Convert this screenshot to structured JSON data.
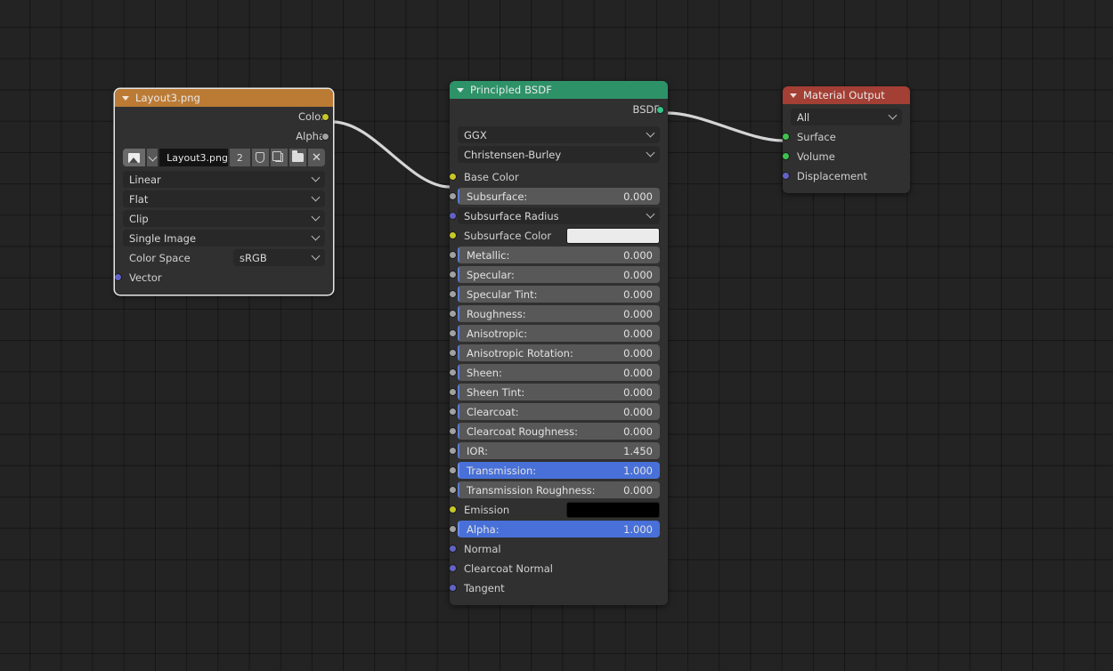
{
  "editor": {
    "name": "Blender Shader Node Editor",
    "background_color": "#232323",
    "grid_color": "#1a1a1a"
  },
  "nodes": {
    "image_texture": {
      "title": "Layout3.png",
      "header_color": "#bb7b35",
      "selected": true,
      "outputs": [
        {
          "label": "Color",
          "socket": "color"
        },
        {
          "label": "Alpha",
          "socket": "gray"
        }
      ],
      "datablock": {
        "image_icon": "image-icon",
        "browse_icon": "chevron-down-icon",
        "name": "Layout3.png",
        "users": "2",
        "fake_user_icon": "shield-icon",
        "new_icon": "copy-icon",
        "open_icon": "folder-icon",
        "unlink_icon": "x-icon"
      },
      "dropdowns": [
        {
          "name": "interpolation",
          "value": "Linear"
        },
        {
          "name": "projection",
          "value": "Flat"
        },
        {
          "name": "extension",
          "value": "Clip"
        },
        {
          "name": "source",
          "value": "Single Image"
        }
      ],
      "color_space": {
        "label": "Color Space",
        "value": "sRGB"
      },
      "inputs": [
        {
          "label": "Vector",
          "socket": "vector"
        }
      ]
    },
    "principled_bsdf": {
      "title": "Principled BSDF",
      "header_color": "#2e9268",
      "selected": false,
      "outputs": [
        {
          "label": "BSDF",
          "socket": "shader"
        }
      ],
      "dropdowns": [
        {
          "name": "distribution",
          "value": "GGX"
        },
        {
          "name": "subsurface-method",
          "value": "Christensen-Burley"
        }
      ],
      "inputs": [
        {
          "label": "Base Color",
          "type": "label",
          "socket": "color"
        },
        {
          "label": "Subsurface:",
          "type": "slider",
          "socket": "gray",
          "value": "0.000",
          "fill": 0
        },
        {
          "label": "Subsurface Radius",
          "type": "dropdown",
          "socket": "vector"
        },
        {
          "label": "Subsurface Color",
          "type": "swatch",
          "socket": "color",
          "color": "#ebebeb"
        },
        {
          "label": "Metallic:",
          "type": "slider",
          "socket": "gray",
          "value": "0.000",
          "fill": 0
        },
        {
          "label": "Specular:",
          "type": "slider",
          "socket": "gray",
          "value": "0.000",
          "fill": 0
        },
        {
          "label": "Specular Tint:",
          "type": "slider",
          "socket": "gray",
          "value": "0.000",
          "fill": 0
        },
        {
          "label": "Roughness:",
          "type": "slider",
          "socket": "gray",
          "value": "0.000",
          "fill": 0
        },
        {
          "label": "Anisotropic:",
          "type": "slider",
          "socket": "gray",
          "value": "0.000",
          "fill": 0
        },
        {
          "label": "Anisotropic Rotation:",
          "type": "slider",
          "socket": "gray",
          "value": "0.000",
          "fill": 0
        },
        {
          "label": "Sheen:",
          "type": "slider",
          "socket": "gray",
          "value": "0.000",
          "fill": 0
        },
        {
          "label": "Sheen Tint:",
          "type": "slider",
          "socket": "gray",
          "value": "0.000",
          "fill": 0
        },
        {
          "label": "Clearcoat:",
          "type": "slider",
          "socket": "gray",
          "value": "0.000",
          "fill": 0
        },
        {
          "label": "Clearcoat Roughness:",
          "type": "slider",
          "socket": "gray",
          "value": "0.000",
          "fill": 0
        },
        {
          "label": "IOR:",
          "type": "slider",
          "socket": "gray",
          "value": "1.450",
          "fill": 0
        },
        {
          "label": "Transmission:",
          "type": "slider",
          "socket": "gray",
          "value": "1.000",
          "fill": 100
        },
        {
          "label": "Transmission Roughness:",
          "type": "slider",
          "socket": "gray",
          "value": "0.000",
          "fill": 0
        },
        {
          "label": "Emission",
          "type": "swatch",
          "socket": "color",
          "color": "#000000"
        },
        {
          "label": "Alpha:",
          "type": "slider",
          "socket": "gray",
          "value": "1.000",
          "fill": 100
        },
        {
          "label": "Normal",
          "type": "label",
          "socket": "vector"
        },
        {
          "label": "Clearcoat Normal",
          "type": "label",
          "socket": "vector"
        },
        {
          "label": "Tangent",
          "type": "label",
          "socket": "vector"
        }
      ]
    },
    "material_output": {
      "title": "Material Output",
      "header_color": "#a33f34",
      "selected": false,
      "target": {
        "name": "target",
        "value": "All"
      },
      "inputs": [
        {
          "label": "Surface",
          "socket": "green"
        },
        {
          "label": "Volume",
          "socket": "green"
        },
        {
          "label": "Displacement",
          "socket": "vector"
        }
      ]
    }
  },
  "links": [
    {
      "from": "image_texture.Color",
      "to": "principled_bsdf.Base Color",
      "color": "#d5d5d5"
    },
    {
      "from": "principled_bsdf.BSDF",
      "to": "material_output.Surface",
      "color": "#d5d5d5"
    }
  ]
}
